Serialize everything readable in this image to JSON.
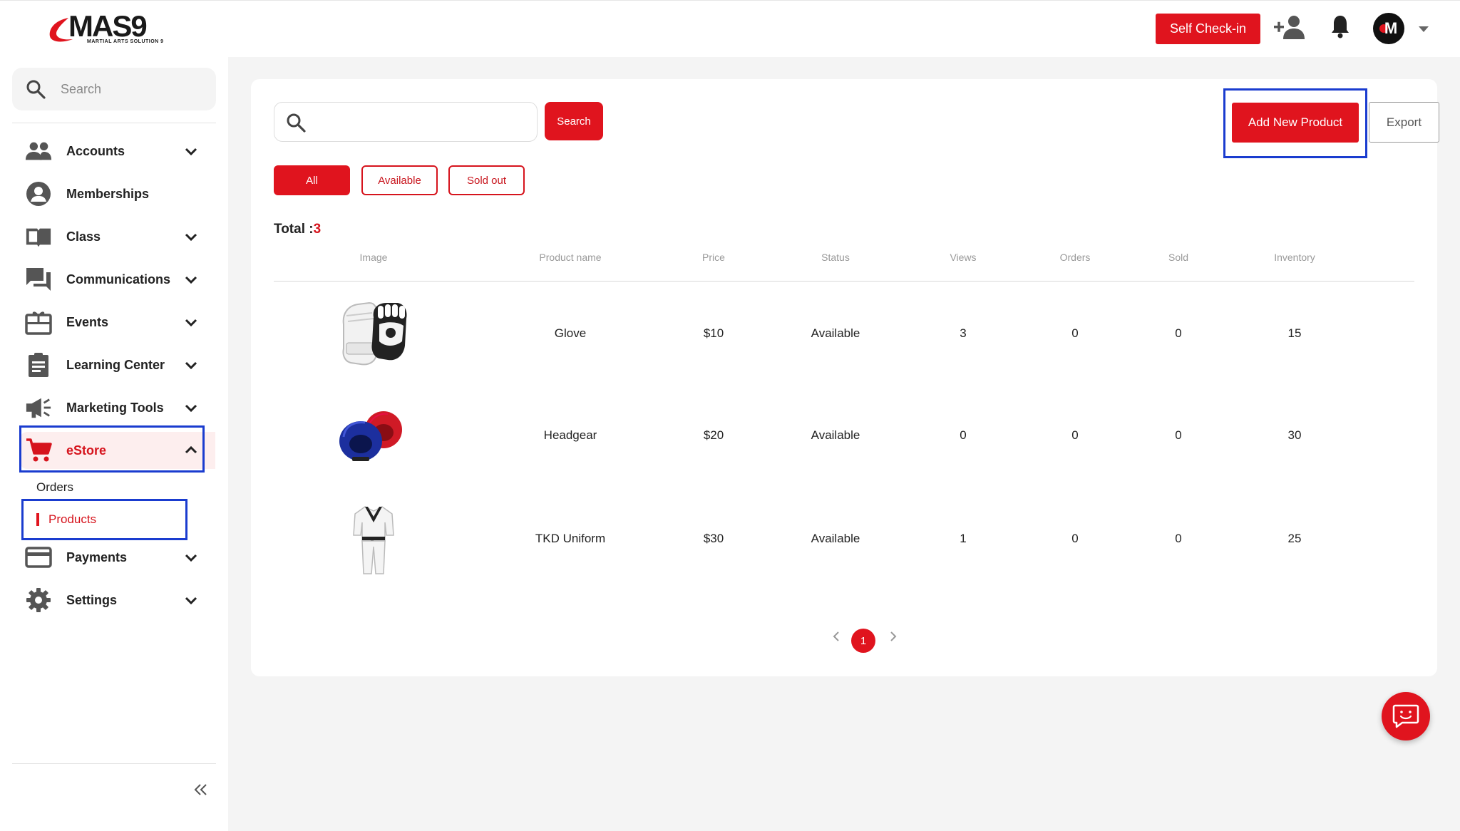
{
  "brand": {
    "logo_text": "MAS9",
    "logo_subtitle": "MARTIAL ARTS SOLUTION 9",
    "accent_color": "#e0141e",
    "highlight_color": "#1a3ccf"
  },
  "header": {
    "checkin_label": "Self Check-in",
    "icons": [
      "add-user-icon",
      "bell-icon",
      "avatar",
      "chevron-down-icon"
    ],
    "avatar_letter": "M"
  },
  "sidebar": {
    "search_placeholder": "Search",
    "items": [
      {
        "label": "Accounts",
        "icon": "people-icon",
        "expandable": true
      },
      {
        "label": "Memberships",
        "icon": "user-circle-icon",
        "expandable": false
      },
      {
        "label": "Class",
        "icon": "book-icon",
        "expandable": true
      },
      {
        "label": "Communications",
        "icon": "chat-icon",
        "expandable": true
      },
      {
        "label": "Events",
        "icon": "gift-calendar-icon",
        "expandable": true
      },
      {
        "label": "Learning Center",
        "icon": "clipboard-icon",
        "expandable": true
      },
      {
        "label": "Marketing Tools",
        "icon": "megaphone-icon",
        "expandable": true
      },
      {
        "label": "eStore",
        "icon": "cart-icon",
        "expandable": true,
        "expanded": true,
        "active": true
      },
      {
        "label": "Payments",
        "icon": "card-icon",
        "expandable": true
      },
      {
        "label": "Settings",
        "icon": "gear-icon",
        "expandable": true
      }
    ],
    "estore_sub": {
      "orders": "Orders",
      "products": "Products"
    }
  },
  "toolbar": {
    "search_value": "",
    "search_label": "Search",
    "add_label": "Add New Product",
    "export_label": "Export"
  },
  "filters": {
    "all": "All",
    "available": "Available",
    "sold_out": "Sold out",
    "selected": "All"
  },
  "total": {
    "label": "Total :",
    "value": "3"
  },
  "table": {
    "columns": [
      "Image",
      "Product name",
      "Price",
      "Status",
      "Views",
      "Orders",
      "Sold",
      "Inventory"
    ],
    "rows": [
      {
        "image": "glove-image",
        "name": "Glove",
        "price": "$10",
        "status": "Available",
        "views": "3",
        "orders": "0",
        "sold": "0",
        "inventory": "15"
      },
      {
        "image": "headgear-image",
        "name": "Headgear",
        "price": "$20",
        "status": "Available",
        "views": "0",
        "orders": "0",
        "sold": "0",
        "inventory": "30"
      },
      {
        "image": "uniform-image",
        "name": "TKD Uniform",
        "price": "$30",
        "status": "Available",
        "views": "1",
        "orders": "0",
        "sold": "0",
        "inventory": "25"
      }
    ]
  },
  "pagination": {
    "current": "1"
  }
}
